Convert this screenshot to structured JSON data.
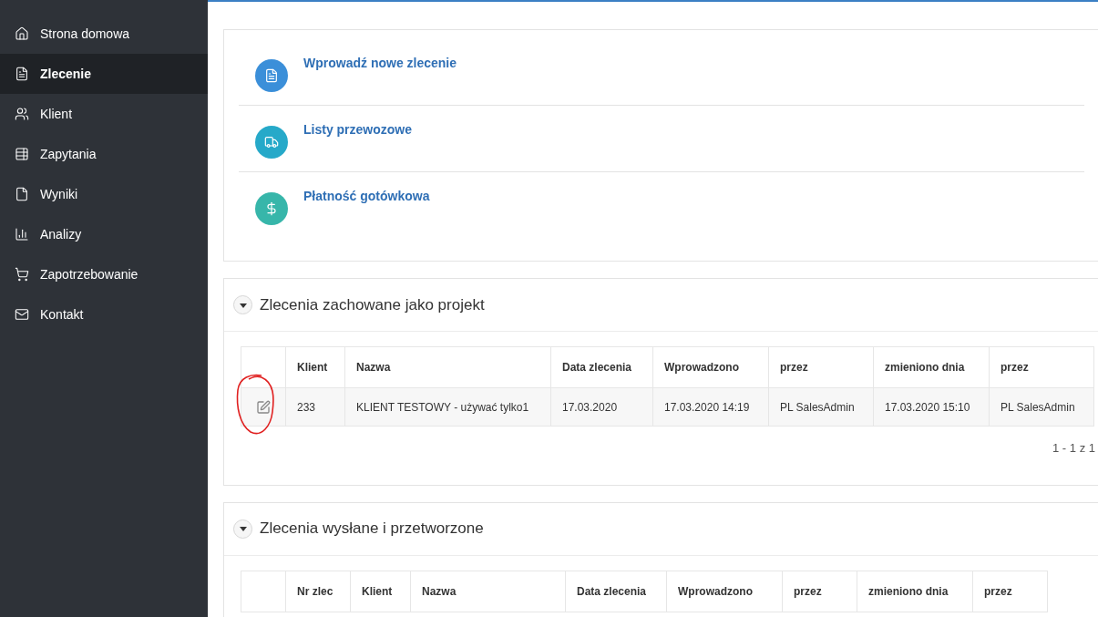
{
  "sidebar": {
    "items": [
      {
        "label": "Strona domowa",
        "selected": false
      },
      {
        "label": "Zlecenie",
        "selected": true
      },
      {
        "label": "Klient",
        "selected": false
      },
      {
        "label": "Zapytania",
        "selected": false
      },
      {
        "label": "Wyniki",
        "selected": false
      },
      {
        "label": "Analizy",
        "selected": false
      },
      {
        "label": "Zapotrzebowanie",
        "selected": false
      },
      {
        "label": "Kontakt",
        "selected": false
      }
    ]
  },
  "actions": [
    {
      "label": "Wprowadź nowe zlecenie",
      "kind": "document",
      "color": "#3b8fd9"
    },
    {
      "label": "Listy przewozowe",
      "kind": "truck",
      "color": "#26a9c9"
    },
    {
      "label": "Płatność gotówkowa",
      "kind": "money",
      "color": "#37b6aa"
    }
  ],
  "sections": [
    {
      "title": "Zlecenia zachowane jako projekt",
      "expanded": true,
      "columns": [
        "",
        "Klient",
        "Nazwa",
        "Data zlecenia",
        "Wprowadzono",
        "przez",
        "zmieniono dnia",
        "przez"
      ],
      "rows": [
        [
          "",
          "233",
          "KLIENT TESTOWY - używać tylko1",
          "17.03.2020",
          "17.03.2020 14:19",
          "PL SalesAdmin",
          "17.03.2020 15:10",
          "PL SalesAdmin"
        ]
      ],
      "pager": "1 - 1 z 1"
    },
    {
      "title": "Zlecenia wysłane i przetworzone",
      "expanded": true,
      "columns": [
        "",
        "Nr zlec",
        "Klient",
        "Nazwa",
        "Data zlecenia",
        "Wprowadzono",
        "przez",
        "zmieniono dnia",
        "przez"
      ]
    }
  ]
}
